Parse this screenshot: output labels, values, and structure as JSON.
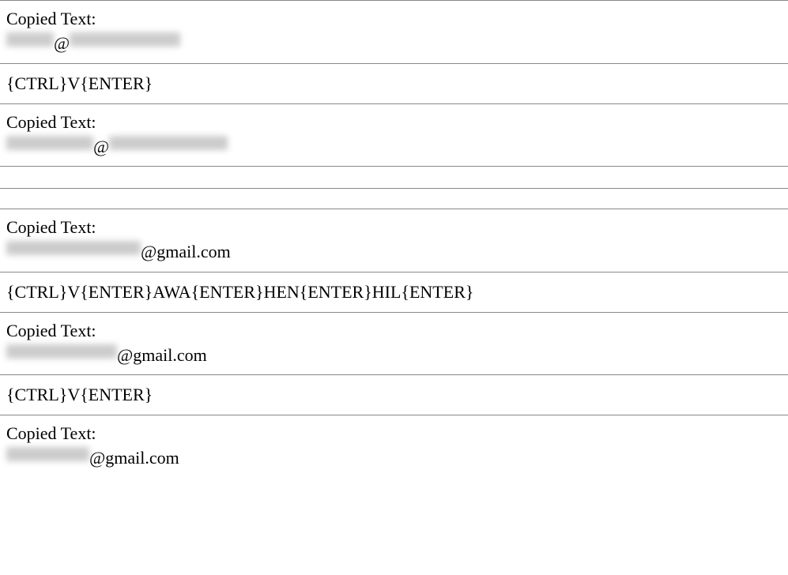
{
  "entries": [
    {
      "type": "copied",
      "label": "Copied Text:",
      "redacted_prefix_width": 60,
      "clear_middle": "@",
      "redacted_suffix_width": 140,
      "clear_suffix": ""
    },
    {
      "type": "keystroke",
      "text": "{CTRL}V{ENTER}"
    },
    {
      "type": "copied",
      "label": "Copied Text:",
      "redacted_prefix_width": 110,
      "clear_middle": "@",
      "redacted_suffix_width": 150,
      "clear_suffix": ""
    },
    {
      "type": "spacer"
    },
    {
      "type": "empty"
    },
    {
      "type": "copied",
      "label": "Copied Text:",
      "redacted_prefix_width": 170,
      "clear_middle": "",
      "redacted_suffix_width": 0,
      "clear_suffix": "@gmail.com"
    },
    {
      "type": "keystroke",
      "text": "{CTRL}V{ENTER}AWA{ENTER}HEN{ENTER}HIL{ENTER}"
    },
    {
      "type": "copied",
      "label": "Copied Text:",
      "redacted_prefix_width": 140,
      "clear_middle": "",
      "redacted_suffix_width": 0,
      "clear_suffix": "@gmail.com"
    },
    {
      "type": "keystroke",
      "text": "{CTRL}V{ENTER}"
    },
    {
      "type": "copied",
      "label": "Copied Text:",
      "redacted_prefix_width": 105,
      "clear_middle": "",
      "redacted_suffix_width": 0,
      "clear_suffix": "@gmail.com"
    }
  ]
}
